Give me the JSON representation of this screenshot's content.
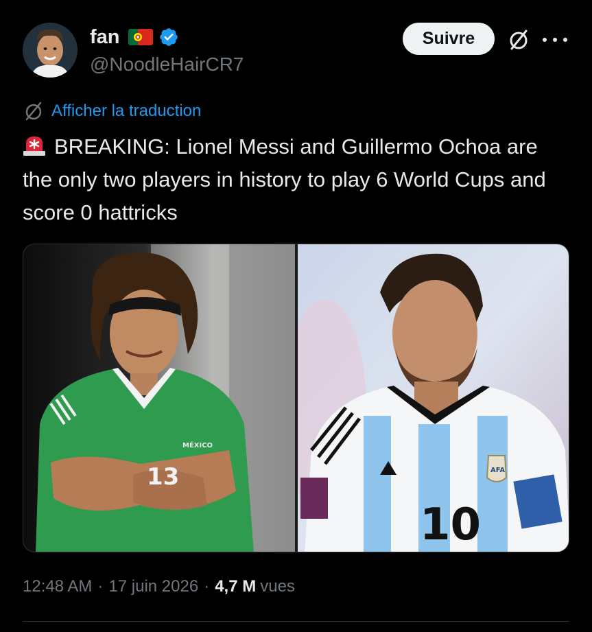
{
  "author": {
    "display_name": "fan",
    "handle": "@NoodleHairCR7",
    "flag_icon": "portugal-flag-icon",
    "verified_icon": "verified-badge-icon",
    "verified_color": "#1d9bf0"
  },
  "actions": {
    "follow_label": "Suivre",
    "grok_icon": "grok-icon",
    "more_icon": "more-horizontal-icon"
  },
  "translate": {
    "label": "Afficher la traduction",
    "icon": "grok-icon",
    "color": "#1d9bf0"
  },
  "tweet": {
    "emoji_icon": "rotating-light-icon",
    "text": "BREAKING: Lionel Messi and Guillermo Ochoa are the only two players in history to play 6 World Cups and score 0 hattricks"
  },
  "media": {
    "left_photo": {
      "jersey_text": "MÉXICO",
      "number": "13"
    },
    "right_photo": {
      "number": "10",
      "badge": "AFA"
    }
  },
  "meta": {
    "time": "12:48 AM",
    "separator": "·",
    "date": "17 juin 2026",
    "views_count": "4,7 M",
    "views_label": "vues"
  }
}
